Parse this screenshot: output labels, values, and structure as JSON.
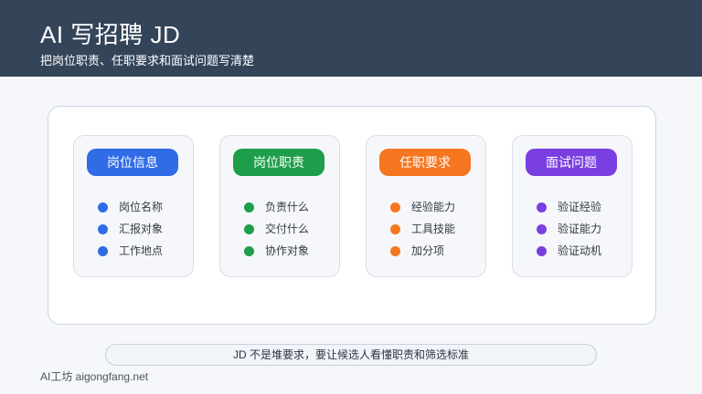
{
  "header": {
    "title": "AI 写招聘 JD",
    "subtitle": "把岗位职责、任职要求和面试问题写清楚"
  },
  "cards": [
    {
      "label": "岗位信息",
      "color": "#2f6ce5",
      "items": [
        "岗位名称",
        "汇报对象",
        "工作地点"
      ]
    },
    {
      "label": "岗位职责",
      "color": "#1e9e4a",
      "items": [
        "负责什么",
        "交付什么",
        "协作对象"
      ]
    },
    {
      "label": "任职要求",
      "color": "#f5761f",
      "items": [
        "经验能力",
        "工具技能",
        "加分项"
      ]
    },
    {
      "label": "面试问题",
      "color": "#7a3fe0",
      "items": [
        "验证经验",
        "验证能力",
        "验证动机"
      ]
    }
  ],
  "footer": {
    "note": "JD 不是堆要求，要让候选人看懂职责和筛选标准"
  },
  "brand": {
    "text": "AI工坊 aigongfang.net"
  }
}
